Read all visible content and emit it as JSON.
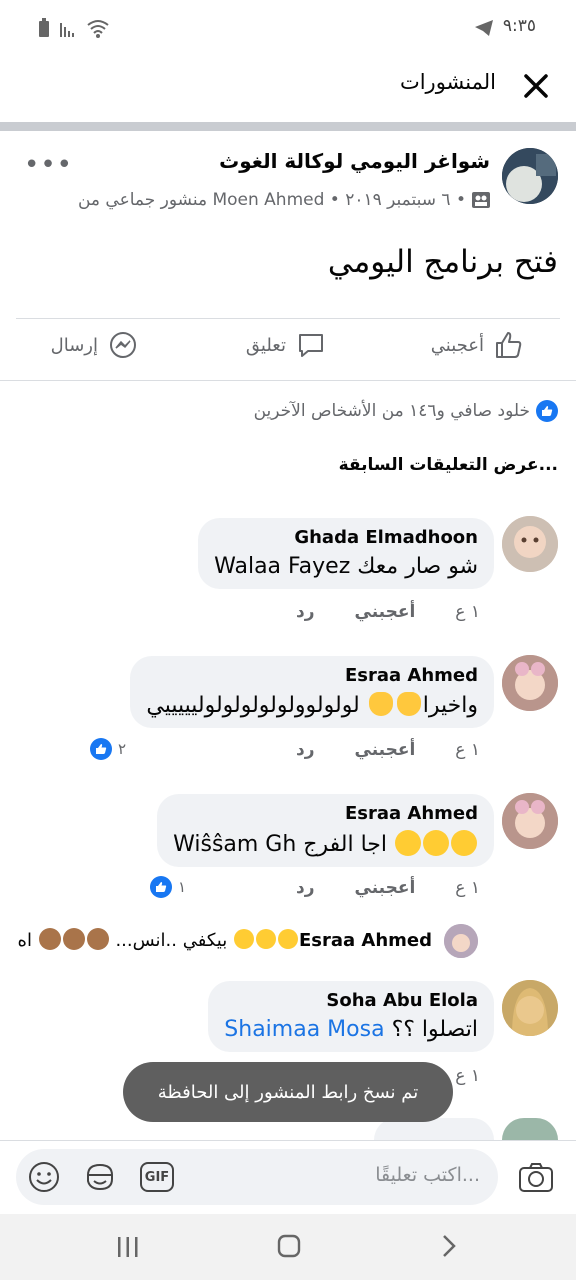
{
  "status_bar": {
    "time": "٩:٣٥"
  },
  "header": {
    "title": "المنشورات"
  },
  "post": {
    "group_name": "شواغر اليومي لوكالة الغوث",
    "meta": "منشور جماعي من Moen Ahmed • ٦ سبتمبر ٢٠١٩ •",
    "text": "فتح برنامج اليومي",
    "actions": {
      "like": "أعجبني",
      "comment": "تعليق",
      "send": "إرسال"
    },
    "likes_summary": "خلود صافي و١٤٦ من الأشخاص الآخرين",
    "view_previous": "عرض التعليقات السابقة..."
  },
  "comments": [
    {
      "author": "Ghada Elmadhoon",
      "text_before": "شو صار معك ",
      "mention": "Walaa Fayez",
      "time": "١ ع",
      "like": "أعجبني",
      "reply": "رد"
    },
    {
      "author": "Esraa Ahmed",
      "text": "لولولوولولولولولوليييييي",
      "text_after": "واخيرا",
      "time": "١ ع",
      "like": "أعجبني",
      "reply": "رد",
      "reaction_count": "٢"
    },
    {
      "author": "Esraa Ahmed",
      "text": "اجا الفرج",
      "mention": "Wiŝŝam Gh",
      "time": "١ ع",
      "like": "أعجبني",
      "reply": "رد",
      "reaction_count": "١"
    },
    {
      "author": "Esraa Ahmed",
      "text": "اه",
      "text_after": "بيكفي ..انس..."
    },
    {
      "author": "Soha Abu Elola",
      "text": "اتصلوا ؟؟",
      "mention": "Shaimaa Mosa",
      "time": "١ ع"
    }
  ],
  "toast": "تم نسخ رابط المنشور إلى الحافظة",
  "composer": {
    "placeholder": "اكتب تعليقًا...",
    "gif_label": "GIF"
  },
  "colors": {
    "accent": "#1877f2",
    "bubble": "#f0f2f5",
    "muted": "#65676b"
  }
}
